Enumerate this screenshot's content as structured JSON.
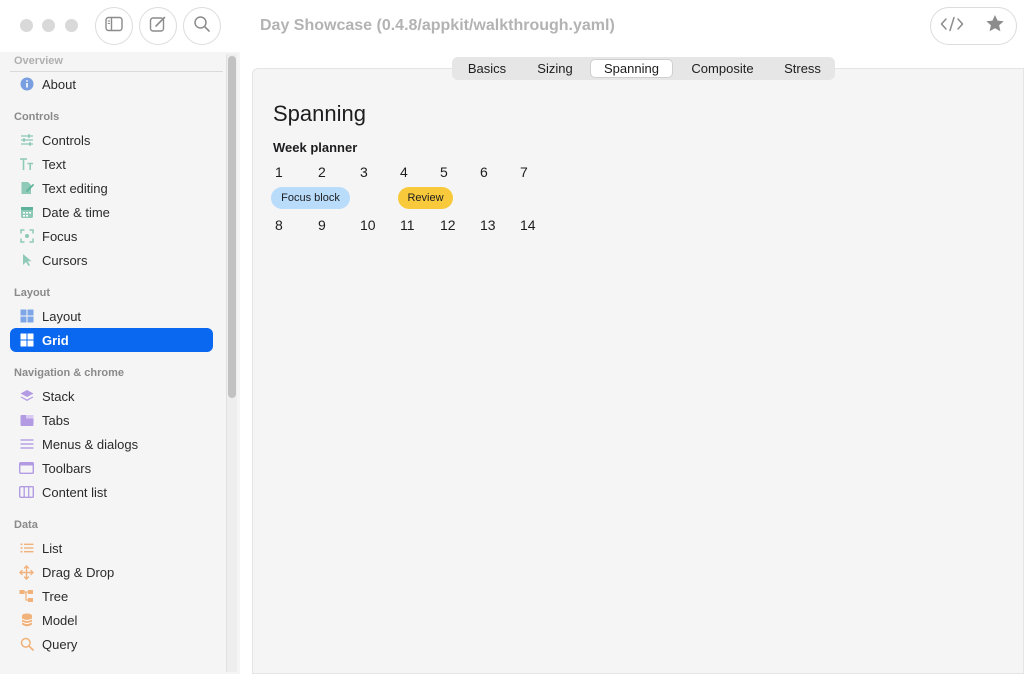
{
  "window": {
    "title": "Day Showcase (0.4.8/appkit/walkthrough.yaml)",
    "toolbar_left_icons": [
      "sidebar-toggle-icon",
      "compose-icon",
      "search-icon"
    ],
    "toolbar_right_icons": [
      "code-icon",
      "star-icon"
    ]
  },
  "sidebar": {
    "sections": [
      {
        "title": "Overview",
        "items": [
          {
            "label": "About",
            "icon": "info-icon"
          }
        ]
      },
      {
        "title": "Controls",
        "items": [
          {
            "label": "Controls",
            "icon": "sliders-icon"
          },
          {
            "label": "Text",
            "icon": "text-icon"
          },
          {
            "label": "Text editing",
            "icon": "document-edit-icon"
          },
          {
            "label": "Date & time",
            "icon": "calendar-icon"
          },
          {
            "label": "Focus",
            "icon": "focus-icon"
          },
          {
            "label": "Cursors",
            "icon": "cursor-icon"
          }
        ]
      },
      {
        "title": "Layout",
        "items": [
          {
            "label": "Layout",
            "icon": "layout-icon"
          },
          {
            "label": "Grid",
            "icon": "grid-icon",
            "selected": true
          }
        ]
      },
      {
        "title": "Navigation & chrome",
        "items": [
          {
            "label": "Stack",
            "icon": "stack-icon"
          },
          {
            "label": "Tabs",
            "icon": "tabs-icon"
          },
          {
            "label": "Menus & dialogs",
            "icon": "menu-icon"
          },
          {
            "label": "Toolbars",
            "icon": "toolbar-icon"
          },
          {
            "label": "Content list",
            "icon": "columns-icon"
          }
        ]
      },
      {
        "title": "Data",
        "items": [
          {
            "label": "List",
            "icon": "list-icon"
          },
          {
            "label": "Drag & Drop",
            "icon": "move-icon"
          },
          {
            "label": "Tree",
            "icon": "tree-icon"
          },
          {
            "label": "Model",
            "icon": "database-icon"
          },
          {
            "label": "Query",
            "icon": "magnifier-icon"
          }
        ]
      }
    ]
  },
  "tabs": [
    {
      "label": "Basics"
    },
    {
      "label": "Sizing"
    },
    {
      "label": "Spanning",
      "active": true
    },
    {
      "label": "Composite"
    },
    {
      "label": "Stress"
    }
  ],
  "content": {
    "heading": "Spanning",
    "subheading": "Week planner",
    "week1": [
      "1",
      "2",
      "3",
      "4",
      "5",
      "6",
      "7"
    ],
    "week2": [
      "8",
      "9",
      "10",
      "11",
      "12",
      "13",
      "14"
    ],
    "events": [
      {
        "label": "Focus block",
        "color": "#b9dcfa"
      },
      {
        "label": "Review",
        "color": "#f8c93a"
      }
    ]
  },
  "colors": {
    "accent": "#0a68f0",
    "panel_bg": "#f5f5f5",
    "sidebar_bg": "#f5f5f5"
  }
}
